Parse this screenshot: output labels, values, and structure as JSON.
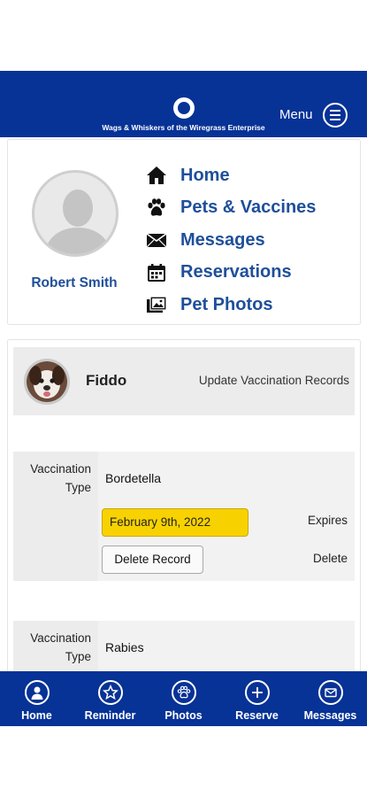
{
  "header": {
    "logo_text": "Wags & Whiskers of the Wiregrass Enterprise",
    "menu_label": "Menu"
  },
  "profile": {
    "name": "Robert Smith"
  },
  "nav": {
    "items": [
      {
        "label": "Home",
        "icon": "home-icon"
      },
      {
        "label": "Pets & Vaccines",
        "icon": "paw-icon"
      },
      {
        "label": "Messages",
        "icon": "envelope-icon"
      },
      {
        "label": "Reservations",
        "icon": "calendar-icon"
      },
      {
        "label": "Pet Photos",
        "icon": "photos-icon"
      }
    ]
  },
  "pet": {
    "name": "Fiddo",
    "action_label": "Update Vaccination Records"
  },
  "records": [
    {
      "type_label": "Vaccination Type",
      "type_value": "Bordetella",
      "expires_label": "Expires",
      "expires_value": "February 9th, 2022",
      "delete_label": "Delete",
      "delete_button": "Delete Record"
    },
    {
      "type_label": "Vaccination Type",
      "type_value": "Rabies"
    }
  ],
  "tabbar": {
    "items": [
      {
        "label": "Home",
        "icon": "person-icon"
      },
      {
        "label": "Reminder",
        "icon": "star-icon"
      },
      {
        "label": "Photos",
        "icon": "paw-icon"
      },
      {
        "label": "Reserve",
        "icon": "plus-icon"
      },
      {
        "label": "Messages",
        "icon": "envelope-icon"
      }
    ]
  },
  "colors": {
    "brand_blue": "#073296",
    "link_blue": "#1f4f9a",
    "date_highlight": "#f8d200"
  }
}
